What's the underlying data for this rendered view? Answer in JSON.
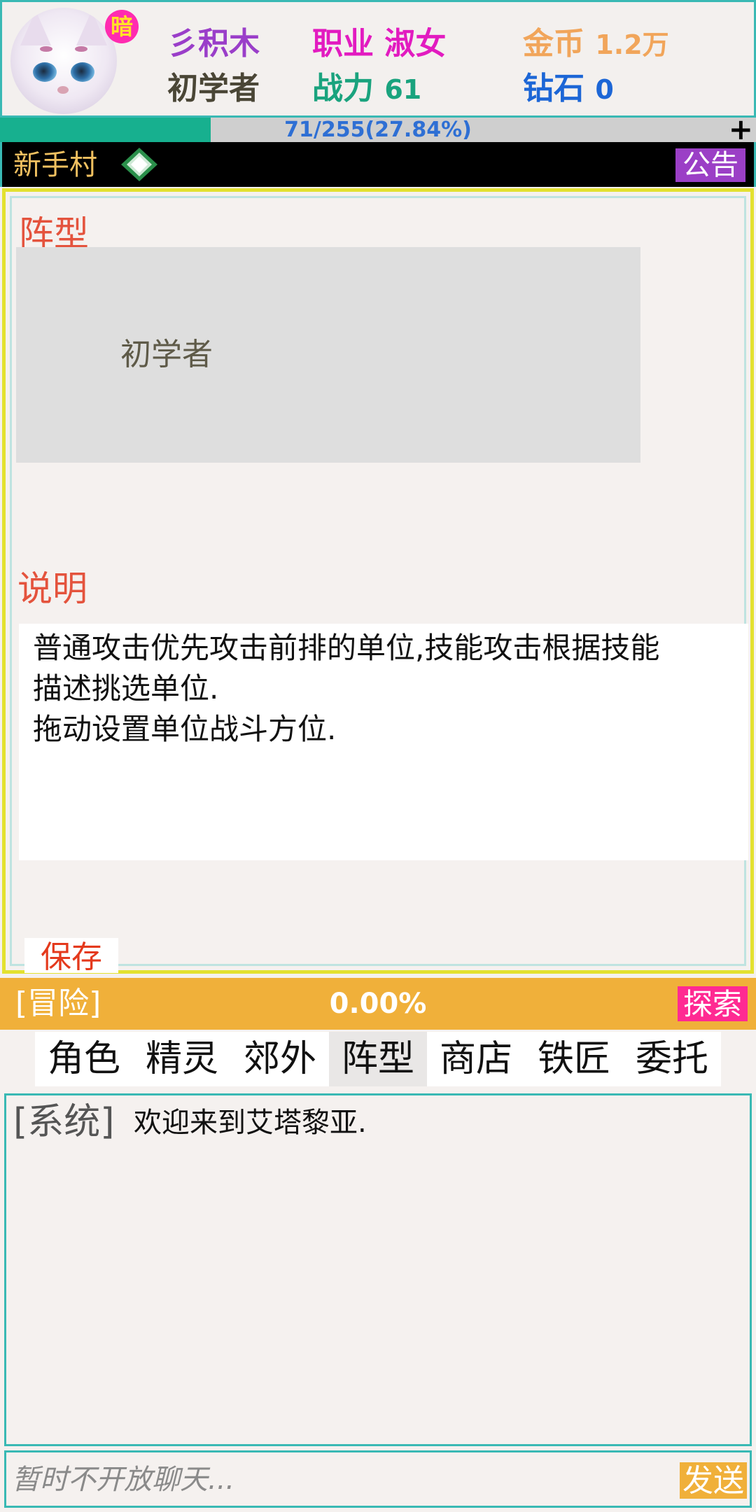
{
  "player": {
    "badge": "暗",
    "name": "彡积木",
    "job_label": "职业",
    "job_value": "淑女",
    "coins_label": "金币",
    "coins_value": "1.2万",
    "title": "初学者",
    "power_label": "战力",
    "power_value": "61",
    "diamonds_label": "钻石",
    "diamonds_value": "0",
    "avatar": "white-cat-avatar"
  },
  "exp": {
    "text": "71/255(27.84%)",
    "percent": 27.84,
    "plus_label": "+"
  },
  "location": {
    "name": "新手村",
    "gem_icon": "diamond-gem-icon",
    "notice_label": "公告"
  },
  "formation": {
    "title": "阵型",
    "slots": [
      [
        "",
        ""
      ],
      [
        "",
        ""
      ],
      [
        "初学者",
        ""
      ],
      [
        "",
        ""
      ],
      [
        "",
        ""
      ]
    ],
    "desc_title": "说明",
    "desc_lines": [
      "普通攻击优先攻击前排的单位,技能攻击根据技能",
      "描述挑选单位.",
      "拖动设置单位战斗方位."
    ],
    "save_label": "保存"
  },
  "adventure": {
    "label": "[冒险]",
    "progress": "0.00%",
    "explore_label": "探索"
  },
  "tabs": [
    "角色",
    "精灵",
    "郊外",
    "阵型",
    "商店",
    "铁匠",
    "委托"
  ],
  "active_tab": "阵型",
  "chat": {
    "tag": "[系统]",
    "message": "欢迎来到艾塔黎亚.",
    "placeholder": "暂时不开放聊天...",
    "send_label": "发送"
  },
  "colors": {
    "teal_border": "#39b9b4",
    "exp_fill": "#17b08f",
    "panel_border": "#e3e130",
    "accent_red": "#e4533d",
    "adventure_orange": "#f0b03a",
    "explore_pink": "#ff2a92",
    "notice_purple": "#9b3fc6"
  }
}
